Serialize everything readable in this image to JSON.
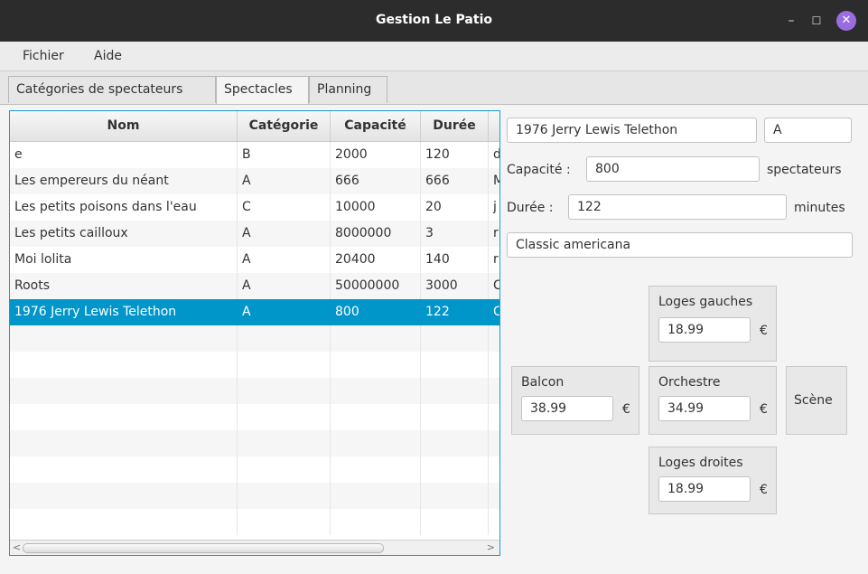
{
  "window": {
    "title": "Gestion Le Patio",
    "minimize": "–",
    "maximize": "☐",
    "close": "✕"
  },
  "menu": {
    "file": "Fichier",
    "help": "Aide"
  },
  "tabs": [
    "Catégories de spectateurs",
    "Spectacles",
    "Planning"
  ],
  "table": {
    "columns": [
      "Nom",
      "Catégorie",
      "Capacité",
      "Durée",
      ""
    ],
    "rows": [
      [
        "e",
        "B",
        "2000",
        "120",
        "d"
      ],
      [
        "Les empereurs du néant",
        "A",
        "666",
        "666",
        "M"
      ],
      [
        "Les petits poisons dans l'eau",
        "C",
        "10000",
        "20",
        "j"
      ],
      [
        "Les petits cailloux",
        "A",
        "8000000",
        "3",
        "r"
      ],
      [
        "Moi lolita",
        "A",
        "20400",
        "140",
        "r"
      ],
      [
        "Roots",
        "A",
        "50000000",
        "3000",
        "C"
      ],
      [
        "1976 Jerry Lewis Telethon",
        "A",
        "800",
        "122",
        "C"
      ]
    ],
    "selected_row": 6,
    "scroll_left": "<",
    "scroll_right": ">"
  },
  "form": {
    "name": "1976 Jerry Lewis Telethon",
    "category": "A",
    "capacity_label": "Capacité :",
    "capacity": "800",
    "capacity_unit": "spectateurs",
    "duration_label": "Durée :",
    "duration": "122",
    "duration_unit": "minutes",
    "description": "Classic americana"
  },
  "prices": {
    "currency": "€",
    "loges_gauches": {
      "label": "Loges gauches",
      "value": "18.99"
    },
    "balcon": {
      "label": "Balcon",
      "value": "38.99"
    },
    "orchestre": {
      "label": "Orchestre",
      "value": "34.99"
    },
    "scene": {
      "label": "Scène"
    },
    "loges_droites": {
      "label": "Loges droites",
      "value": "18.99"
    }
  },
  "colors": {
    "accent": "#0096c9",
    "titlebar": "#2c2c2c",
    "close_button": "#9a6ce0"
  }
}
